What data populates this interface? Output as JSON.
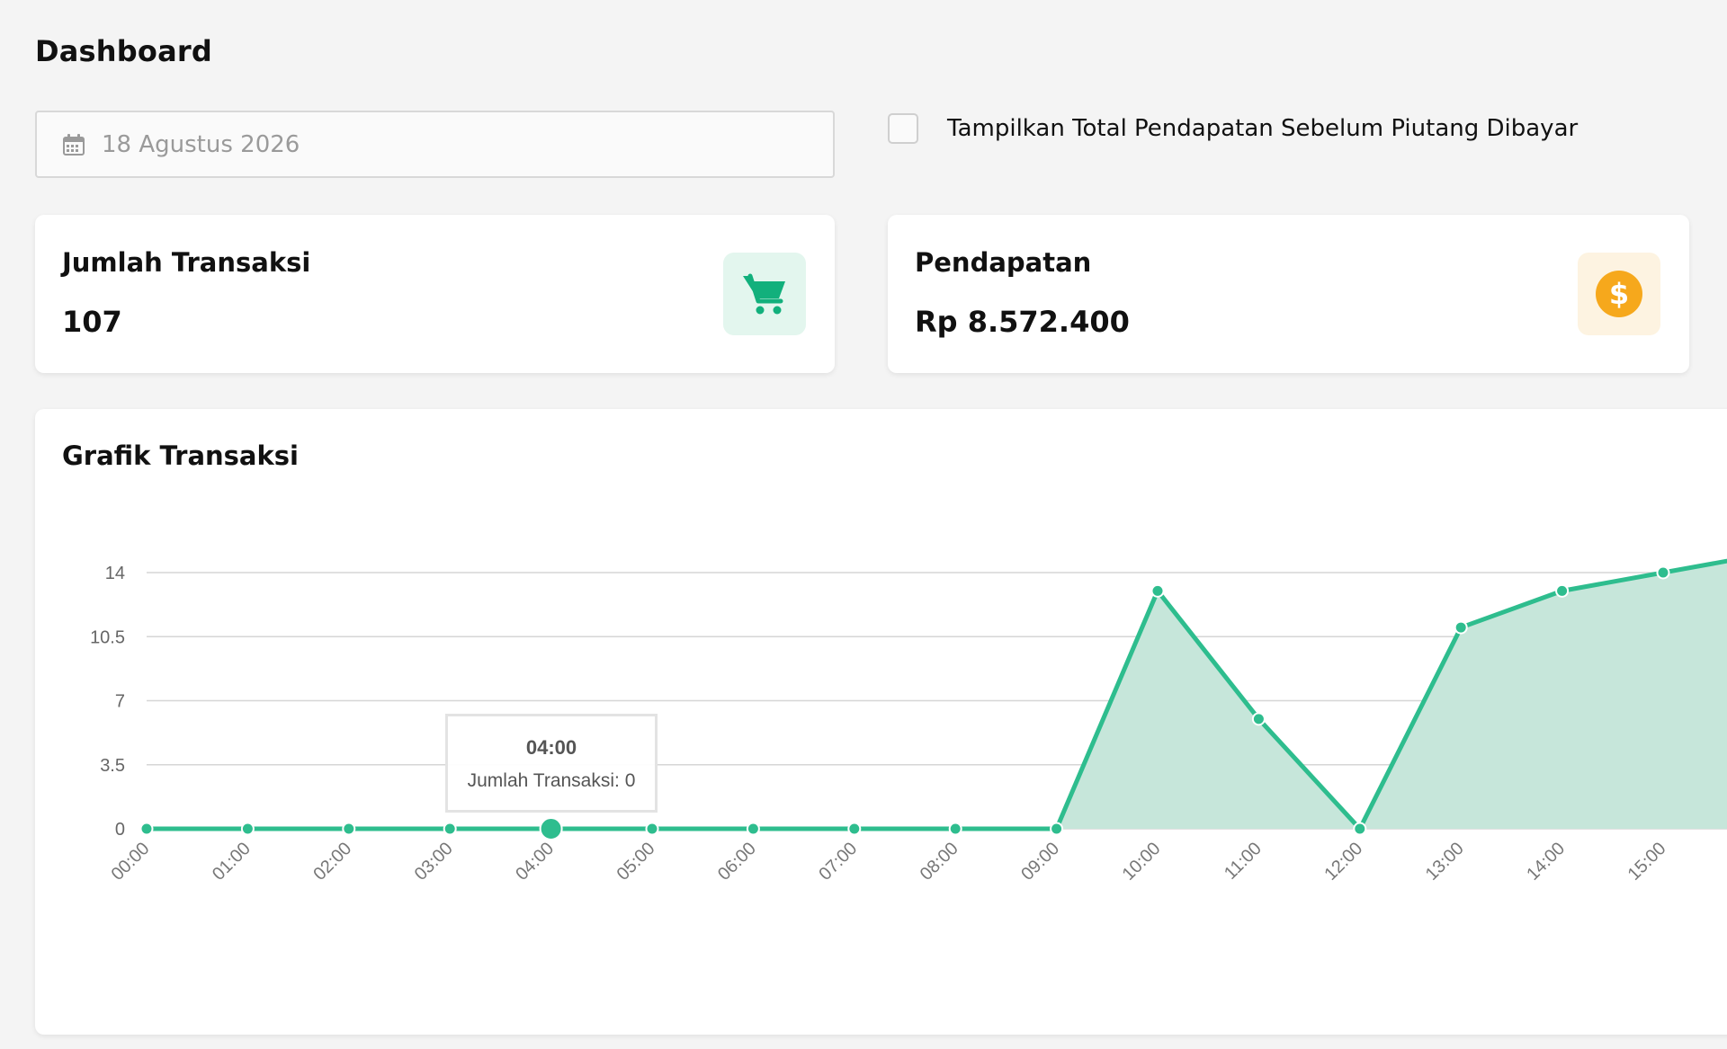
{
  "header": {
    "title": "Dashboard"
  },
  "filters": {
    "date_value": "18 Agustus 2026",
    "checkbox_label": "Tampilkan Total Pendapatan Sebelum Piutang Dibayar",
    "checkbox_checked": false
  },
  "stats": {
    "transactions": {
      "title": "Jumlah Transaksi",
      "value": "107",
      "icon": "cart-icon",
      "icon_color": "#12b07c",
      "icon_bg": "#e3f6ee"
    },
    "revenue": {
      "title": "Pendapatan",
      "value": "Rp 8.572.400",
      "icon": "dollar-icon",
      "icon_color": "#f6a81c",
      "icon_bg": "#fdf3e1"
    }
  },
  "chart": {
    "title": "Grafik Transaksi",
    "tooltip": {
      "title": "04:00",
      "body": "Jumlah Transaksi: 0"
    }
  },
  "colors": {
    "accent": "#2ebd8e",
    "area_fill": "#c6e6da",
    "grid": "#d6d6d6"
  },
  "chart_data": {
    "type": "area",
    "categories": [
      "00:00",
      "01:00",
      "02:00",
      "03:00",
      "04:00",
      "05:00",
      "06:00",
      "07:00",
      "08:00",
      "09:00",
      "10:00",
      "11:00",
      "12:00",
      "13:00",
      "14:00",
      "15:00"
    ],
    "series": [
      {
        "values": [
          0,
          0,
          0,
          0,
          0,
          0,
          0,
          0,
          0,
          0,
          13,
          6,
          0,
          11,
          13,
          14
        ]
      }
    ],
    "yticks": [
      "0",
      "3.5",
      "7",
      "10.5",
      "14"
    ],
    "ylim": [
      0,
      14
    ],
    "highlighted_category": "04:00",
    "grid": true
  }
}
